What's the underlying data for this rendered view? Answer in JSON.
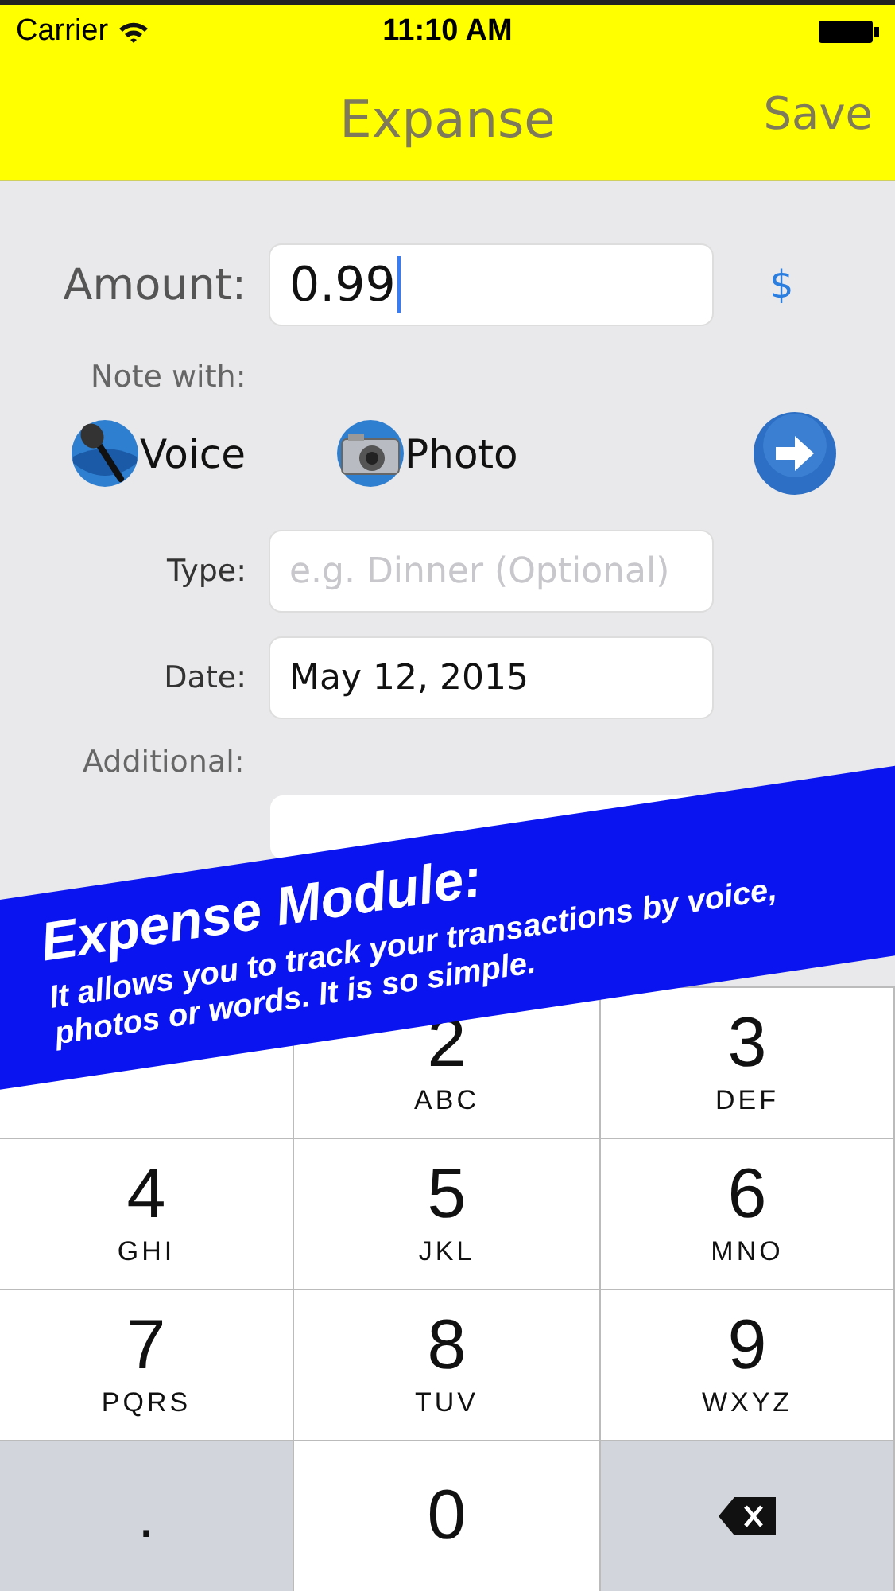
{
  "status_bar": {
    "carrier": "Carrier",
    "time": "11:10 AM"
  },
  "nav_bar": {
    "title": "Expanse",
    "action": "Save"
  },
  "amount": {
    "label": "Amount:",
    "value": "0.99",
    "currency": "$"
  },
  "note_with": {
    "label": "Note with:",
    "options": [
      {
        "kind": "voice",
        "label": "Voice"
      },
      {
        "kind": "photo",
        "label": "Photo"
      }
    ]
  },
  "fields": [
    {
      "label": "Type:",
      "placeholder": "e.g. Dinner (Optional)"
    },
    {
      "label": "Date:",
      "value": "May 12, 2015"
    }
  ],
  "additional": {
    "label": "Additional:"
  },
  "banner": {
    "title": "Expense Module:",
    "text": "It allows you to track your transactions by voice, photos or words. It is so simple."
  },
  "keypad": [
    {
      "kind": "blank"
    },
    {
      "kind": "digit",
      "digit": "2",
      "letters": "ABC"
    },
    {
      "kind": "digit",
      "digit": "3",
      "letters": "DEF"
    },
    {
      "kind": "digit",
      "digit": "4",
      "letters": "GHI"
    },
    {
      "kind": "digit",
      "digit": "5",
      "letters": "JKL"
    },
    {
      "kind": "digit",
      "digit": "6",
      "letters": "MNO"
    },
    {
      "kind": "digit",
      "digit": "7",
      "letters": "PQRS"
    },
    {
      "kind": "digit",
      "digit": "8",
      "letters": "TUV"
    },
    {
      "kind": "digit",
      "digit": "9",
      "letters": "WXYZ"
    },
    {
      "kind": "symbol",
      "symbol": "."
    },
    {
      "kind": "digit",
      "digit": "0"
    },
    {
      "kind": "delete"
    }
  ]
}
